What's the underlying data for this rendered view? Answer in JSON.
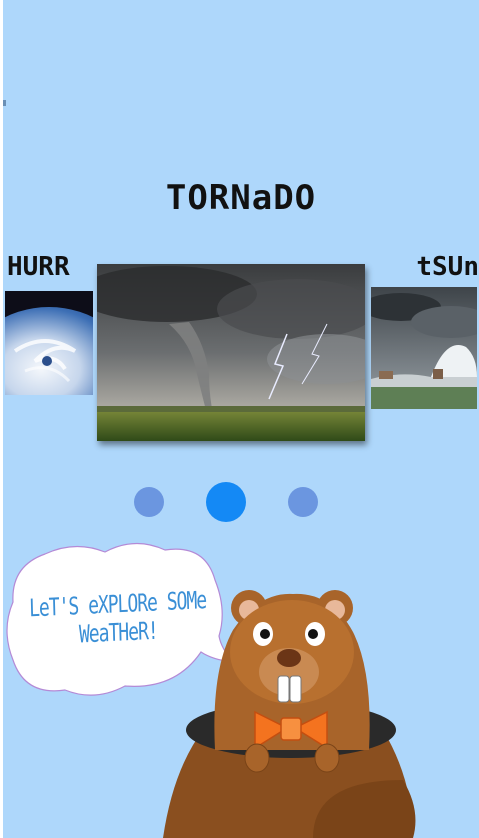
{
  "carousel": {
    "current_title": "TORNaDO",
    "prev_label": "HURR",
    "next_label": "tSUn",
    "slides": [
      {
        "name": "hurricane",
        "image_icon": "hurricane-satellite-image"
      },
      {
        "name": "tornado",
        "image_icon": "tornado-photo-image"
      },
      {
        "name": "tsunami",
        "image_icon": "tsunami-wave-image"
      }
    ],
    "active_index": 1,
    "page_count": 3
  },
  "speech_bubble": {
    "text": "LeT'S eXPLORe SOMe WeaTHeR!"
  },
  "mascot": {
    "icon": "groundhog-bowtie-icon"
  },
  "colors": {
    "background": "#aed7fb",
    "dot_active": "#1489f5",
    "dot_inactive": "#6b96e0",
    "bubble_text": "#3a8fd6",
    "bowtie": "#f4731f"
  }
}
